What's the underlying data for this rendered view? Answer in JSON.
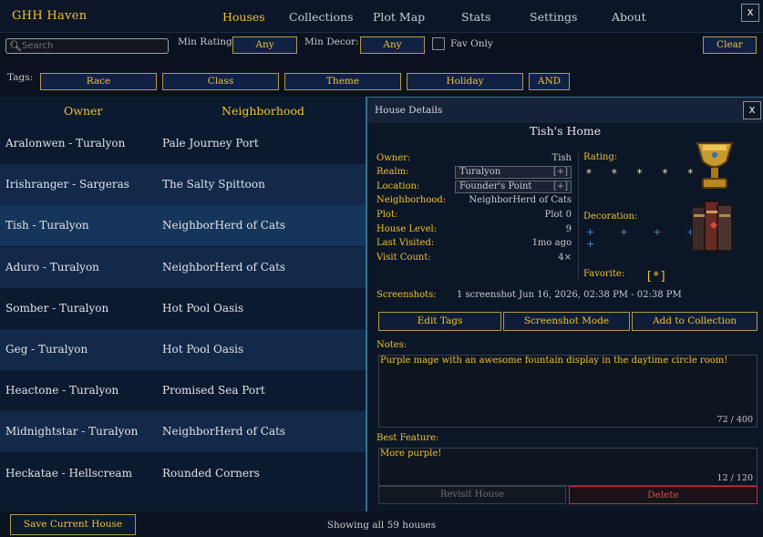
{
  "app": {
    "title": "GHH Haven",
    "close": "x"
  },
  "nav": [
    "Houses",
    "Collections",
    "Plot Map",
    "Stats",
    "Settings",
    "About"
  ],
  "filters": {
    "search_placeholder": "Search",
    "min_rating_label": "Min Rating:",
    "min_rating_value": "Any",
    "min_decor_label": "Min Decor:",
    "min_decor_value": "Any",
    "fav_only_label": "Fav Only",
    "clear": "Clear",
    "tags_label": "Tags:",
    "tags": [
      "Race",
      "Class",
      "Theme",
      "Holiday"
    ],
    "tag_mode": "AND"
  },
  "list": {
    "headers": {
      "owner": "Owner",
      "neighborhood": "Neighborhood"
    },
    "rows": [
      {
        "owner": "Aralonwen - Turalyon",
        "neighborhood": "Pale Journey Port"
      },
      {
        "owner": "Irishranger - Sargeras",
        "neighborhood": "The Salty Spittoon"
      },
      {
        "owner": "Tish - Turalyon",
        "neighborhood": "NeighborHerd of Cats"
      },
      {
        "owner": "Aduro - Turalyon",
        "neighborhood": "NeighborHerd of Cats"
      },
      {
        "owner": "Somber - Turalyon",
        "neighborhood": "Hot Pool Oasis"
      },
      {
        "owner": "Geg - Turalyon",
        "neighborhood": "Hot Pool Oasis"
      },
      {
        "owner": "Heactone - Turalyon",
        "neighborhood": "Promised Sea Port"
      },
      {
        "owner": "Midnightstar - Turalyon",
        "neighborhood": "NeighborHerd of Cats"
      },
      {
        "owner": "Heckatae - Hellscream",
        "neighborhood": "Rounded Corners"
      }
    ],
    "selected_index": 2
  },
  "details": {
    "panel_title": "House Details",
    "close": "x",
    "house_name": "Tish's Home",
    "owner_label": "Owner:",
    "owner": "Tish",
    "realm_label": "Realm:",
    "realm": "Turalyon",
    "location_label": "Location:",
    "location": "Founder's Point",
    "expand": "[+]",
    "neighborhood_label": "Neighborhood:",
    "neighborhood": "NeighborHerd of Cats",
    "plot_label": "Plot:",
    "plot": "Plot 0",
    "house_level_label": "House Level:",
    "house_level": "9",
    "last_visited_label": "Last Visited:",
    "last_visited": "1mo ago",
    "visit_count_label": "Visit Count:",
    "visit_count": "4×",
    "rating_label": "Rating:",
    "rating_stars": "* * * * *",
    "decoration_label": "Decoration:",
    "decoration_marks": "+ + + + + +",
    "favorite_label": "Favorite:",
    "favorite_mark": "[*]",
    "screenshots_label": "Screenshots:",
    "screenshots": "1 screenshot Jun 16, 2026, 02:38 PM - 02:38 PM",
    "actions": {
      "edit_tags": "Edit Tags",
      "screenshot_mode": "Screenshot Mode",
      "add_to_collection": "Add to Collection"
    },
    "notes_label": "Notes:",
    "notes": "Purple mage with an awesome fountain display in the daytime circle room!",
    "notes_count": "72 / 400",
    "best_feature_label": "Best Feature:",
    "best_feature": "More purple!",
    "best_feature_count": "12 / 120",
    "revisit": "Revisit House",
    "delete": "Delete"
  },
  "bottom": {
    "save": "Save Current House",
    "status": "Showing all 59 houses"
  },
  "colors": {
    "accent": "#f2c230",
    "selected_row": "#16355a",
    "delete": "#c0303a"
  }
}
